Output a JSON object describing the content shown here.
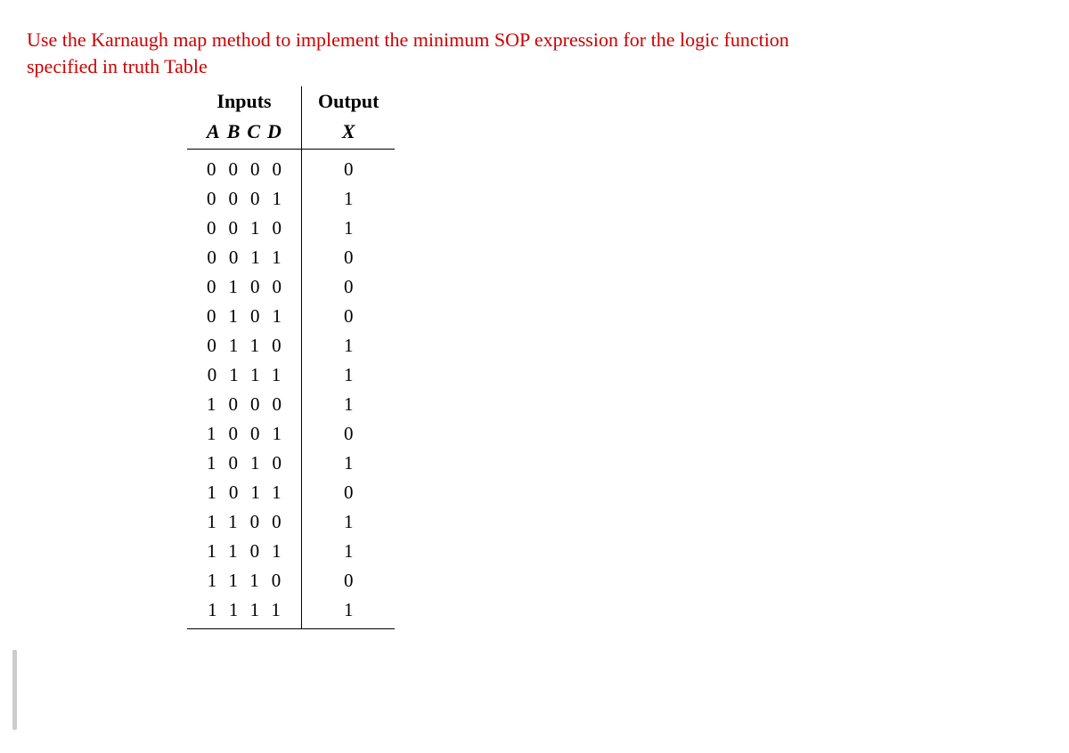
{
  "question": "Use the Karnaugh map method to implement the minimum SOP expression for the logic function specified in truth Table",
  "table": {
    "header_inputs": "Inputs",
    "header_output": "Output",
    "sub_inputs": "ABCD",
    "sub_output": "X",
    "rows": [
      {
        "a": "0",
        "b": "0",
        "c": "0",
        "d": "0",
        "x": "0"
      },
      {
        "a": "0",
        "b": "0",
        "c": "0",
        "d": "1",
        "x": "1"
      },
      {
        "a": "0",
        "b": "0",
        "c": "1",
        "d": "0",
        "x": "1"
      },
      {
        "a": "0",
        "b": "0",
        "c": "1",
        "d": "1",
        "x": "0"
      },
      {
        "a": "0",
        "b": "1",
        "c": "0",
        "d": "0",
        "x": "0"
      },
      {
        "a": "0",
        "b": "1",
        "c": "0",
        "d": "1",
        "x": "0"
      },
      {
        "a": "0",
        "b": "1",
        "c": "1",
        "d": "0",
        "x": "1"
      },
      {
        "a": "0",
        "b": "1",
        "c": "1",
        "d": "1",
        "x": "1"
      },
      {
        "a": "1",
        "b": "0",
        "c": "0",
        "d": "0",
        "x": "1"
      },
      {
        "a": "1",
        "b": "0",
        "c": "0",
        "d": "1",
        "x": "0"
      },
      {
        "a": "1",
        "b": "0",
        "c": "1",
        "d": "0",
        "x": "1"
      },
      {
        "a": "1",
        "b": "0",
        "c": "1",
        "d": "1",
        "x": "0"
      },
      {
        "a": "1",
        "b": "1",
        "c": "0",
        "d": "0",
        "x": "1"
      },
      {
        "a": "1",
        "b": "1",
        "c": "0",
        "d": "1",
        "x": "1"
      },
      {
        "a": "1",
        "b": "1",
        "c": "1",
        "d": "0",
        "x": "0"
      },
      {
        "a": "1",
        "b": "1",
        "c": "1",
        "d": "1",
        "x": "1"
      }
    ]
  }
}
